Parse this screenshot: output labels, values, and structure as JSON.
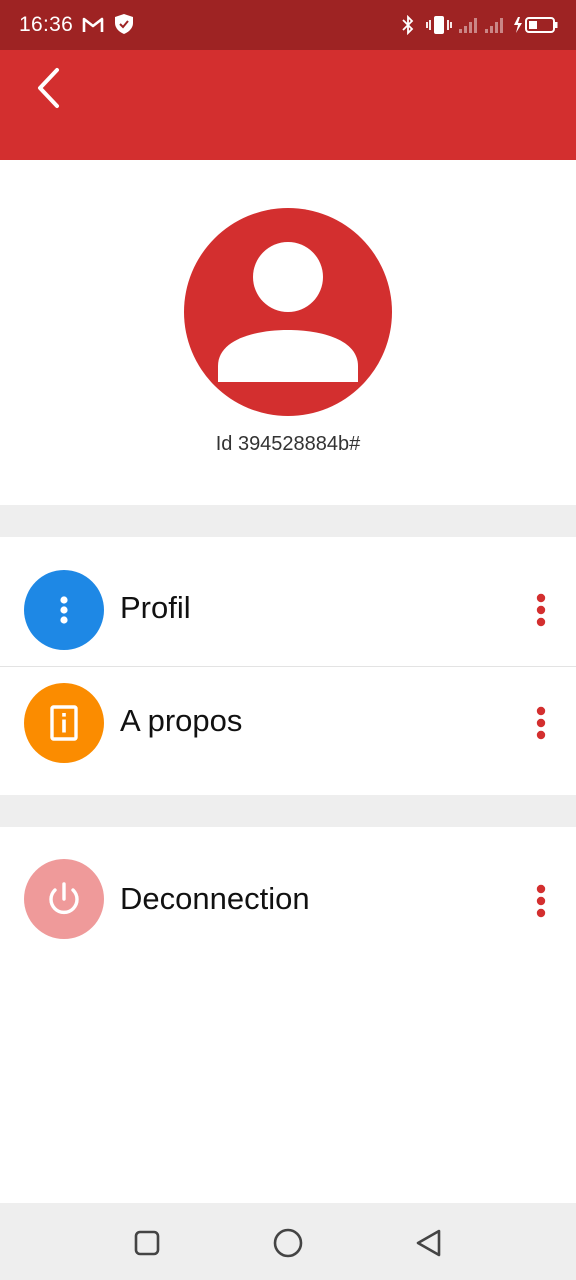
{
  "status_bar": {
    "time": "16:36",
    "left_icons": [
      "gmail-icon",
      "shield-icon"
    ],
    "right_icons": [
      "bluetooth-icon",
      "vibrate-icon",
      "signal-icon",
      "signal-icon",
      "battery-icon"
    ]
  },
  "app_bar": {
    "back_icon": "chevron-left-icon"
  },
  "profile": {
    "id_label": "Id 394528884b#",
    "avatar_icon": "person-icon"
  },
  "menu": [
    {
      "label": "Profil",
      "icon": "dots-vertical-icon",
      "color": "#1e88e5"
    },
    {
      "label": "A propos",
      "icon": "info-icon",
      "color": "#fb8c00"
    },
    {
      "label": "Deconnection",
      "icon": "power-icon",
      "color": "#ef9a9a"
    }
  ],
  "colors": {
    "primary": "#d32f2f",
    "status_bar": "#9e2323",
    "divider": "#eeeeee"
  },
  "nav_bar": {
    "buttons": [
      "recents-square-icon",
      "home-circle-icon",
      "back-triangle-icon"
    ]
  }
}
